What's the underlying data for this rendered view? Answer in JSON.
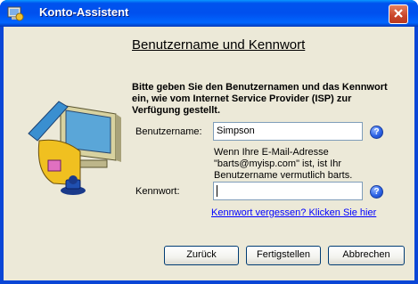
{
  "window": {
    "title": "Konto-Assistent",
    "icon": "account-wizard-icon",
    "close_icon": "close-icon"
  },
  "page": {
    "heading": "Benutzername und Kennwort",
    "instruction": "Bitte geben Sie den Benutzernamen und das Kennwort ein, wie vom Internet Service Provider (ISP) zur Verfügung gestellt."
  },
  "form": {
    "username_label": "Benutzername:",
    "username_value": "Simpson",
    "username_note": "Wenn Ihre E-Mail-Adresse \"barts@myisp.com\" ist, ist Ihr Benutzername vermutlich barts.",
    "password_label": "Kennwort:",
    "password_value": "",
    "forgot_link": "Kennwort vergessen? Klicken Sie hier"
  },
  "buttons": {
    "back": "Zurück",
    "finish": "Fertigstellen",
    "cancel": "Abbrechen"
  },
  "colors": {
    "titlebar": "#0053ee",
    "dialog_bg": "#ece9d8",
    "link": "#0000ff"
  }
}
